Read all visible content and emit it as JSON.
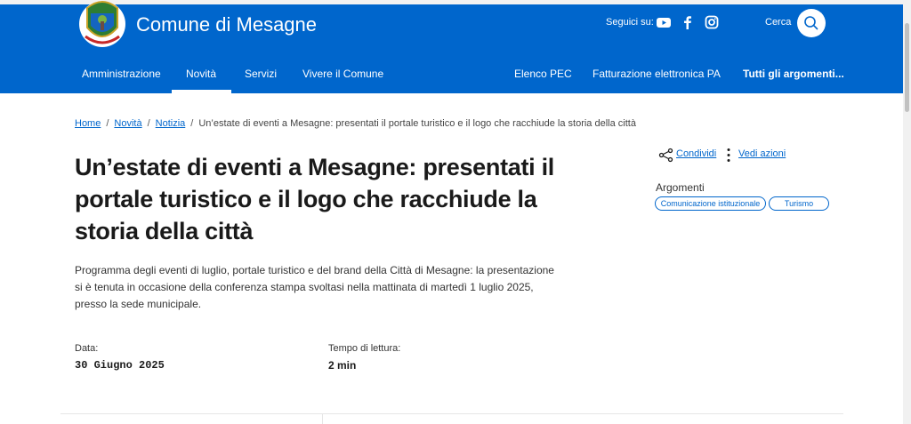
{
  "header": {
    "site_name": "Comune di Mesagne",
    "follow_label": "Seguici su:",
    "social": [
      {
        "icon": "youtube-icon"
      },
      {
        "icon": "facebook-icon"
      },
      {
        "icon": "instagram-icon"
      }
    ],
    "search_label": "Cerca",
    "nav_main": [
      "Amministrazione",
      "Novità",
      "Servizi",
      "Vivere il Comune"
    ],
    "nav_secondary": [
      "Elenco PEC",
      "Fatturazione elettronica PA",
      "Tutti gli argomenti..."
    ],
    "active_nav": "Novità",
    "color": "#0066cc"
  },
  "breadcrumb": {
    "items": [
      "Home",
      "Novità",
      "Notizia"
    ],
    "current": "Un’estate di eventi a Mesagne: presentati il portale turistico e il logo che racchiude la storia della città"
  },
  "article": {
    "title": "Un’estate di eventi a Mesagne: presentati il portale turistico e il logo che racchiude la storia della città",
    "description": "Programma degli eventi di luglio, portale turistico e del brand della Città di Mesagne: la presentazione si è tenuta in occasione della conferenza stampa svoltasi nella mattinata di martedì 1 luglio 2025, presso la sede municipale.",
    "date_label": "Data:",
    "date_value": "30 Giugno 2025",
    "reading_label": "Tempo di lettura:",
    "reading_value": "2 min"
  },
  "sidebar": {
    "share_label": "Condividi",
    "actions_label": "Vedi azioni",
    "topics_label": "Argomenti",
    "topics": [
      "Comunicazione istituzionale",
      "Turismo"
    ]
  }
}
